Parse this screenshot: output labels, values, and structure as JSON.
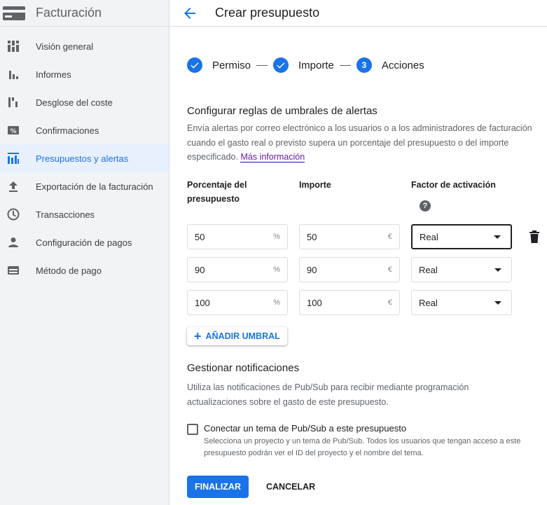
{
  "sidebar": {
    "title": "Facturación",
    "items": [
      {
        "label": "Visión general",
        "icon": "dashboard-icon"
      },
      {
        "label": "Informes",
        "icon": "bar-chart-icon"
      },
      {
        "label": "Desglose del coste",
        "icon": "cost-breakdown-icon"
      },
      {
        "label": "Confirmaciones",
        "icon": "percent-icon"
      },
      {
        "label": "Presupuestos y alertas",
        "icon": "budget-icon",
        "active": true
      },
      {
        "label": "Exportación de la facturación",
        "icon": "upload-icon"
      },
      {
        "label": "Transacciones",
        "icon": "clock-icon"
      },
      {
        "label": "Configuración de pagos",
        "icon": "person-icon"
      },
      {
        "label": "Método de pago",
        "icon": "credit-card-icon"
      }
    ]
  },
  "header": {
    "title": "Crear presupuesto"
  },
  "stepper": {
    "steps": [
      {
        "label": "Permiso",
        "state": "done"
      },
      {
        "label": "Importe",
        "state": "done"
      },
      {
        "label": "Acciones",
        "number": "3",
        "state": "current"
      }
    ]
  },
  "thresholds": {
    "title": "Configurar reglas de umbrales de alertas",
    "description": "Envía alertas por correo electrónico a los usuarios o a los administradores de facturación cuando el gasto real o previsto supera un porcentaje del presupuesto o del importe especificado.",
    "link": "Más información",
    "col_percent_line1": "Porcentaje del",
    "col_percent_line2": "presupuesto",
    "col_amount": "Importe",
    "col_trigger": "Factor de activación",
    "help": "?",
    "rows": [
      {
        "percent": "50",
        "percent_unit": "%",
        "amount": "50",
        "amount_unit": "€",
        "trigger": "Real"
      },
      {
        "percent": "90",
        "percent_unit": "%",
        "amount": "90",
        "amount_unit": "€",
        "trigger": "Real"
      },
      {
        "percent": "100",
        "percent_unit": "%",
        "amount": "100",
        "amount_unit": "€",
        "trigger": "Real"
      }
    ],
    "add_label": "AÑADIR UMBRAL"
  },
  "notifications": {
    "title": "Gestionar notificaciones",
    "description": "Utiliza las notificaciones de Pub/Sub para recibir mediante programación actualizaciones sobre el gasto de este presupuesto.",
    "checkbox_label": "Conectar un tema de Pub/Sub a este presupuesto",
    "checkbox_sub": "Selecciona un proyecto y un tema de Pub/Sub. Todos los usuarios que tengan acceso a este presupuesto podrán ver el ID del proyecto y el nombre del tema."
  },
  "actions": {
    "finish": "FINALIZAR",
    "cancel": "CANCELAR"
  },
  "colors": {
    "accent": "#1a73e8",
    "active_bg": "#e8f0fe",
    "sidebar_bg": "#f1f3f4"
  }
}
